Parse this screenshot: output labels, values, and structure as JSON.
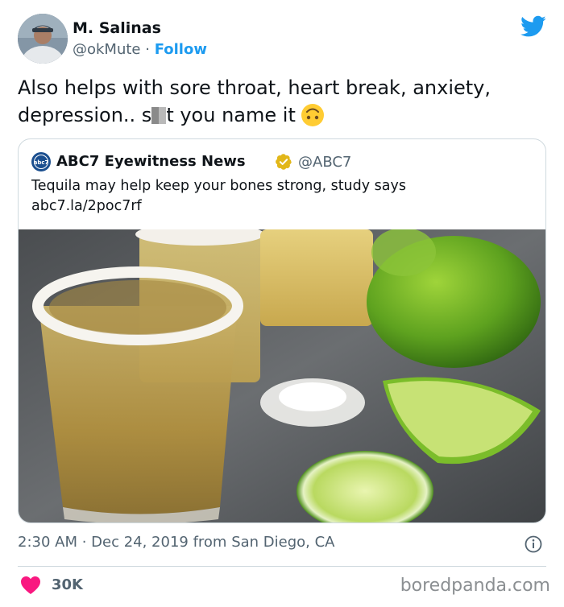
{
  "user": {
    "name": "M. Salinas",
    "handle": "@okMute",
    "separator": " · ",
    "follow_label": "Follow"
  },
  "tweet": {
    "text_before": "Also helps with sore throat, heart break, anxiety, depression.. s",
    "text_after": "t you name it",
    "emoji": "upside-down-face-emoji"
  },
  "quoted": {
    "name": "ABC7 Eyewitness News",
    "handle": "@ABC7",
    "text": "Tequila may help keep your bones strong, study says",
    "link": "abc7.la/2poc7rf",
    "logo_text": "abc7"
  },
  "meta": {
    "timestamp": "2:30 AM · Dec 24, 2019 from San Diego, CA"
  },
  "actions": {
    "likes": "30K"
  },
  "watermark": "boredpanda.com",
  "colors": {
    "accent": "#1d9bf0",
    "heart": "#f91880",
    "verified": "#e2b719",
    "text": "#0f1419",
    "muted": "#536471"
  }
}
